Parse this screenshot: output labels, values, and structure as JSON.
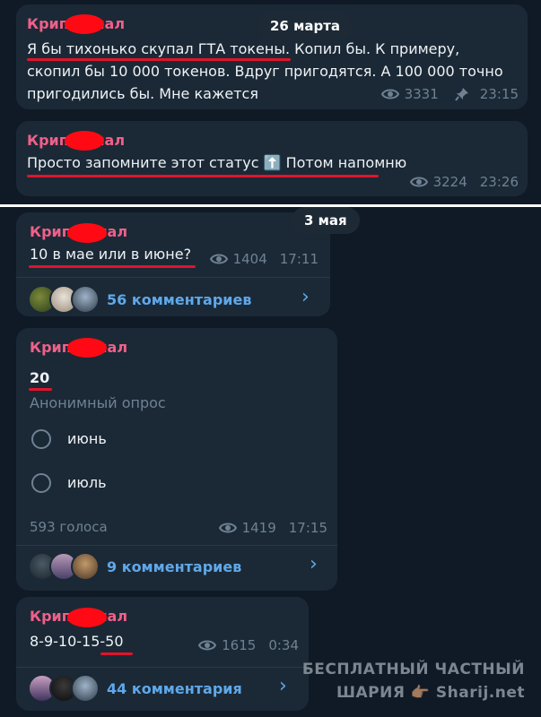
{
  "posts_top": [
    {
      "author": "Крип⬤анал",
      "date_pill": "26 марта",
      "lines": [
        "Я бы тихонько скупал ГТА токены. Копил бы. К примеру,",
        "скопил бы 10 000 токенов. Вдруг пригодятся. А 100 000 точно",
        "пригодились бы. Мне кажется"
      ],
      "views": "3331",
      "time": "23:15",
      "pinned": true
    },
    {
      "author": "Крип⬤анал",
      "text": "Просто запомните этот статус ⬆️ Потом напомню",
      "views": "3224",
      "time": "23:26"
    }
  ],
  "date_pill_2": "3 мая",
  "post_may_1": {
    "author": "Крип⬤анал",
    "text": "10 в мае или в июне?",
    "views": "1404",
    "time": "17:11",
    "comments": "56 комментариев"
  },
  "post_poll": {
    "author": "Крип⬤анал",
    "question": "20",
    "poll_type": "Анонимный опрос",
    "options": [
      "июнь",
      "июль"
    ],
    "votes": "593 голоса",
    "views": "1419",
    "time": "17:15",
    "comments": "9 комментариев"
  },
  "post_last": {
    "author": "Крип⬤анал",
    "text": "8-9-10-15-50",
    "views": "1615",
    "time": "0:34",
    "comments": "44 комментария"
  },
  "watermark": {
    "line1": "БЕСПЛАТНЫЙ ЧАСТНЫЙ",
    "line2": "ШАРИЯ 👉🏽 Sharij.net"
  },
  "colors": {
    "background": "#0f1a26",
    "bubble": "#1b2936",
    "author": "#f0608a",
    "link": "#5fa8ea",
    "redaction": "#ff0a14",
    "underline": "#e0142a"
  }
}
